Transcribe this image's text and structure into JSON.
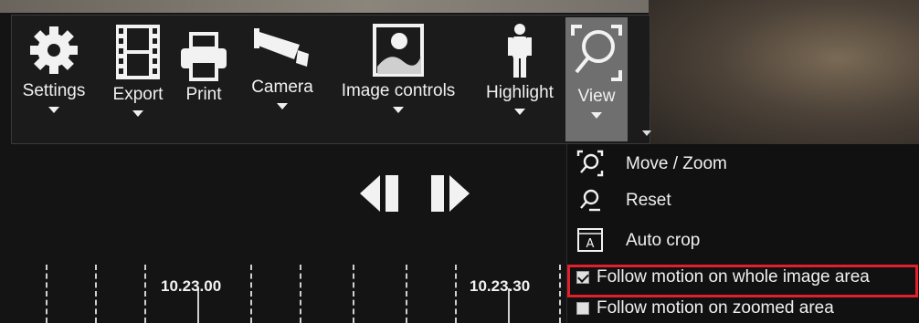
{
  "toolbar": {
    "settings_label": "Settings",
    "export_label": "Export",
    "print_label": "Print",
    "camera_label": "Camera",
    "image_controls_label": "Image controls",
    "highlight_label": "Highlight",
    "view_label": "View"
  },
  "view_menu": {
    "items": [
      {
        "label": "Move / Zoom",
        "icon": "magnifier-frame-icon"
      },
      {
        "label": "Reset",
        "icon": "magnifier-reset-icon"
      },
      {
        "label": "Auto crop",
        "icon": "auto-crop-icon"
      }
    ],
    "follow_whole": {
      "label": "Follow motion on whole image area",
      "checked": true
    },
    "follow_zoomed": {
      "label": "Follow motion on zoomed area",
      "checked": false
    }
  },
  "timeline": {
    "labels": [
      "10.23.00",
      "10.23.30"
    ]
  },
  "colors": {
    "highlight_outline": "#e0202a",
    "active_button": "#6f6f6f"
  }
}
